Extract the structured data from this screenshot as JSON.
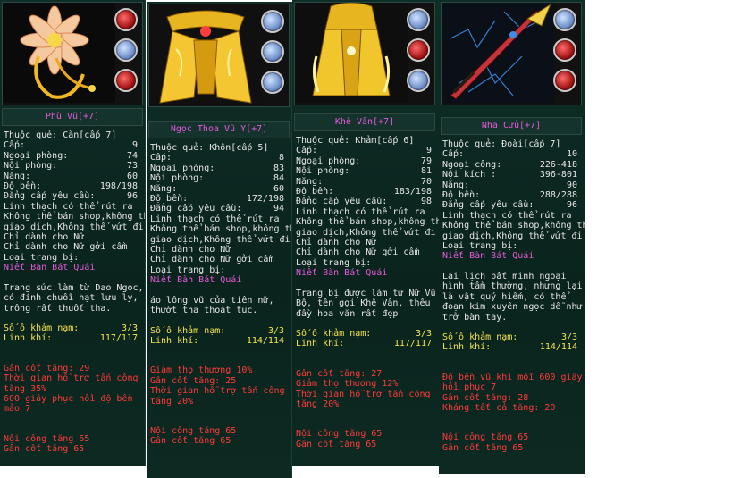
{
  "panels": [
    {
      "title": "Phù Vũ[+7]",
      "gems": [
        "red",
        "blue",
        "red"
      ],
      "stats": [
        {
          "label": "Thuộc quẻ:  Càn[cấp 7]",
          "value": ""
        },
        {
          "label": "Cấp:",
          "value": "9"
        },
        {
          "label": "Ngoại phòng:",
          "value": "74"
        },
        {
          "label": "Nội phòng:",
          "value": "73"
        },
        {
          "label": "Năng:",
          "value": "60"
        },
        {
          "label": "Độ bền:",
          "value": "198/198"
        },
        {
          "label": "Đẳng cấp yêu cầu:",
          "value": "96"
        }
      ],
      "info": [
        "Linh thạch có thể rút ra",
        "Không thể bán shop,không thể",
        "giao dịch,Không thể vứt đi",
        "Chỉ dành cho Nữ",
        "Chỉ dành cho Nữ gởi cầm",
        "Loại trang bị:"
      ],
      "type": "Niết Bàn Bát Quái",
      "desc": [
        "Trang sức làm từ Dao Ngọc,",
        "có đính chuỗi hạt lưu ly,",
        "trông rất thuốt tha."
      ],
      "sockets": {
        "label": "Số ô khảm nạm:",
        "value": "3/3"
      },
      "spirit": {
        "label": "Linh khí:",
        "value": "117/117"
      },
      "red": [
        "Gân cốt tăng: 29",
        "Thời gian hỗ trợ tấn công",
        "tăng 35%",
        "600 giây phục hồi độ bền",
        "mảo 7"
      ],
      "bottom": [
        "Nội công tăng 65",
        "Gân cốt tăng 65"
      ]
    },
    {
      "title": "Ngọc Thoa Vũ Y[+7]",
      "gems": [
        "blue",
        "blue",
        "blue"
      ],
      "stats": [
        {
          "label": "Thuộc quẻ: Khôn[cấp 5]",
          "value": ""
        },
        {
          "label": "Cấp:",
          "value": "8"
        },
        {
          "label": "Ngoại phòng:",
          "value": "83"
        },
        {
          "label": "Nội phòng:",
          "value": "84"
        },
        {
          "label": "Năng:",
          "value": "60"
        },
        {
          "label": "Độ bền:",
          "value": "172/198"
        },
        {
          "label": "Đẳng cấp yêu cầu:",
          "value": "94"
        }
      ],
      "info": [
        "Linh thạch có thể rút ra",
        "Không thể bán shop,không thể",
        "giao dịch,Không thể vứt đi",
        "Chỉ dành cho Nữ",
        "Chỉ dành cho Nữ gởi cầm",
        "Loại trang bị:"
      ],
      "type": "Niết Bàn Bát Quái",
      "desc": [
        "áo lông vũ của tiên nữ,",
        "thướt tha thoát tục."
      ],
      "sockets": {
        "label": "Số ô khảm nạm:",
        "value": "3/3"
      },
      "spirit": {
        "label": "Linh khí:",
        "value": "114/114"
      },
      "red": [
        "Giảm thọ thương 10%",
        "Gân cốt tăng: 25",
        "Thời gian hỗ trợ tấn công",
        "tăng 20%"
      ],
      "bottom": [
        "Nội công tăng 65",
        "Gân cốt tăng 65"
      ]
    },
    {
      "title": "Khê Vân[+7]",
      "gems": [
        "blue",
        "red",
        "blue"
      ],
      "stats": [
        {
          "label": "Thuộc quẻ: Khảm[cấp 6]",
          "value": ""
        },
        {
          "label": "Cấp:",
          "value": "9"
        },
        {
          "label": "Ngoại phòng:",
          "value": "79"
        },
        {
          "label": "Nội phòng:",
          "value": "81"
        },
        {
          "label": "Năng:",
          "value": "70"
        },
        {
          "label": "Độ bền:",
          "value": "183/198"
        },
        {
          "label": "Đẳng cấp yêu cầu:",
          "value": "98"
        }
      ],
      "info": [
        "Linh thạch có thể rút ra",
        "Không thể bán shop,không thể",
        "giao dịch,Không thể vứt đi",
        "Chỉ dành cho Nữ",
        "Chỉ dành cho Nữ gởi cầm",
        "Loại trang bị:"
      ],
      "type": "Niết Bàn Bát Quái",
      "desc": [
        "Trang bị được làm từ Nữ Vũ",
        "Bộ, tên gọi Khê Vân, thêu",
        "đầy hoa văn rất đẹp"
      ],
      "sockets": {
        "label": "Số ô khảm nạm:",
        "value": "3/3"
      },
      "spirit": {
        "label": "Linh khí:",
        "value": "117/117"
      },
      "red": [
        "Gân cốt tăng: 27",
        "Giảm thọ thương 12%",
        "Thời gian hỗ trợ tấn công",
        "tăng 20%"
      ],
      "bottom": [
        "Nội công tăng 65",
        "Gân cốt tăng 65"
      ]
    },
    {
      "title": "Nha Cửu[+7]",
      "gems": [
        "blue",
        "red",
        "red"
      ],
      "stats": [
        {
          "label": "Thuộc quẻ: Đoài[cấp 7]",
          "value": ""
        },
        {
          "label": "Cấp:",
          "value": "10"
        },
        {
          "label": "Ngoại công:",
          "value": "226-418"
        },
        {
          "label": "Nội kích :",
          "value": "396-801"
        },
        {
          "label": "Năng:",
          "value": "90"
        },
        {
          "label": "Độ bền:",
          "value": "288/288"
        },
        {
          "label": "Đẳng cấp yêu cầu:",
          "value": "96"
        }
      ],
      "info": [
        "Linh thạch có thể rút ra",
        "Không thể bán shop,không thể",
        "giao dịch,Không thể vứt đi",
        "Loại trang bị:"
      ],
      "type": "Niết Bàn Bát Quái",
      "desc": [
        "Lai lịch bất minh ngoại",
        "hình tầm thường, nhưng lại",
        "là vật quý hiếm, có thể",
        "đoạn kim xuyên ngọc dễ như",
        "trở bàn tay."
      ],
      "sockets": {
        "label": "Số ô khảm nạm:",
        "value": "3/3"
      },
      "spirit": {
        "label": "Linh khí:",
        "value": "114/114"
      },
      "red": [
        "Độ bền vũ khí mỗi 600 giây",
        "hồi phục 7",
        "Gân cốt tăng: 28",
        "Kháng tất cả tăng: 20"
      ],
      "bottom": [
        "Nội công tăng 65",
        "Gân cốt tăng 65"
      ]
    }
  ]
}
